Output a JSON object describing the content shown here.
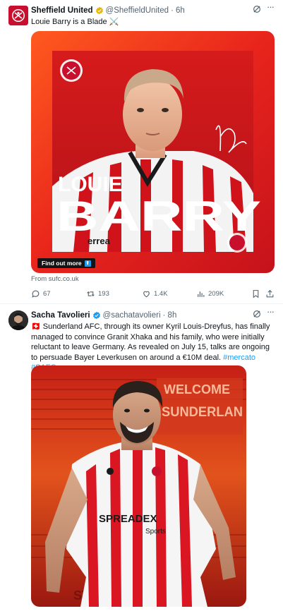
{
  "tweets": [
    {
      "author": "Sheffield United",
      "handle": "@SheffieldUnited",
      "time": "· 6h",
      "text": "Louie Barry is a Blade ⚔️",
      "card": {
        "headline_first": "LOUIE",
        "headline_last": "BARRY",
        "signature": "L Barry",
        "button": "Find out more",
        "source": "From sufc.co.uk"
      },
      "stats": {
        "replies": "67",
        "reposts": "193",
        "likes": "1.4K",
        "views": "209K"
      }
    },
    {
      "author": "Sacha Tavolieri",
      "handle": "@sachatavolieri",
      "time": "· 8h",
      "text": "🇨🇭 Sunderland AFC, through its owner Kyril Louis-Dreyfus, has finally managed to convince Granit Xhaka and his family, who were initially reluctant to leave Germany. As revealed on July 15, talks are ongoing to persuade Bayer Leverkusen on around a €10M deal.",
      "hashtags": "#mercato #SAFC",
      "image": {
        "banner_line1": "WELCOME",
        "banner_line2": "SUNDERLAN",
        "shirt_sponsor": "SPREADEX",
        "shirt_sponsor_sub": "Sports",
        "ground_text": "ST. PR"
      }
    }
  ],
  "colors": {
    "accent": "#1d9bf0",
    "muted": "#536471",
    "sufc_red": "#e41e26",
    "gold": "#f4b400"
  },
  "icons": [
    "grok-icon",
    "more-icon",
    "reply-icon",
    "repost-icon",
    "like-icon",
    "views-icon",
    "bookmark-icon",
    "share-icon"
  ]
}
